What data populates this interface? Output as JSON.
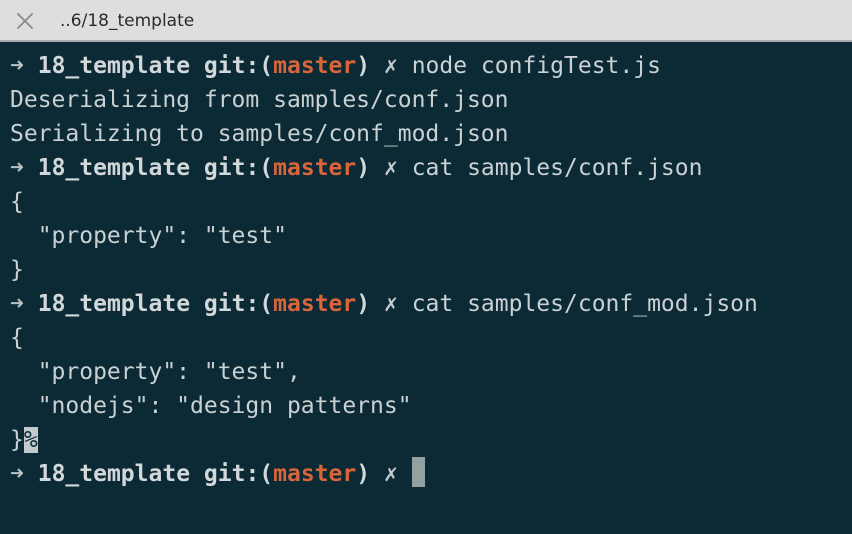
{
  "tab": {
    "title": "..6/18_template",
    "close_icon": "close-icon"
  },
  "colors": {
    "background": "#0c2a35",
    "branch": "#d9653b",
    "text": "#c9d1d3",
    "tabbar": "#dedede"
  },
  "prompt": {
    "arrow": "➜",
    "dir": "18_template",
    "git_label": "git:",
    "open_paren": "(",
    "branch": "master",
    "close_paren": ")",
    "dirty": "✗"
  },
  "lines": [
    {
      "type": "prompt",
      "cmd": "node configTest.js"
    },
    {
      "type": "output",
      "text": "Deserializing from samples/conf.json"
    },
    {
      "type": "output",
      "text": "Serializing to samples/conf_mod.json"
    },
    {
      "type": "prompt",
      "cmd": "cat samples/conf.json"
    },
    {
      "type": "output",
      "text": "{"
    },
    {
      "type": "output",
      "text": "  \"property\": \"test\""
    },
    {
      "type": "output",
      "text": "}"
    },
    {
      "type": "prompt",
      "cmd": "cat samples/conf_mod.json"
    },
    {
      "type": "output",
      "text": "{"
    },
    {
      "type": "output",
      "text": "  \"property\": \"test\","
    },
    {
      "type": "output",
      "text": "  \"nodejs\": \"design patterns\""
    },
    {
      "type": "eol",
      "text": "}",
      "marker": "%"
    },
    {
      "type": "prompt-cursor",
      "cmd": ""
    }
  ]
}
